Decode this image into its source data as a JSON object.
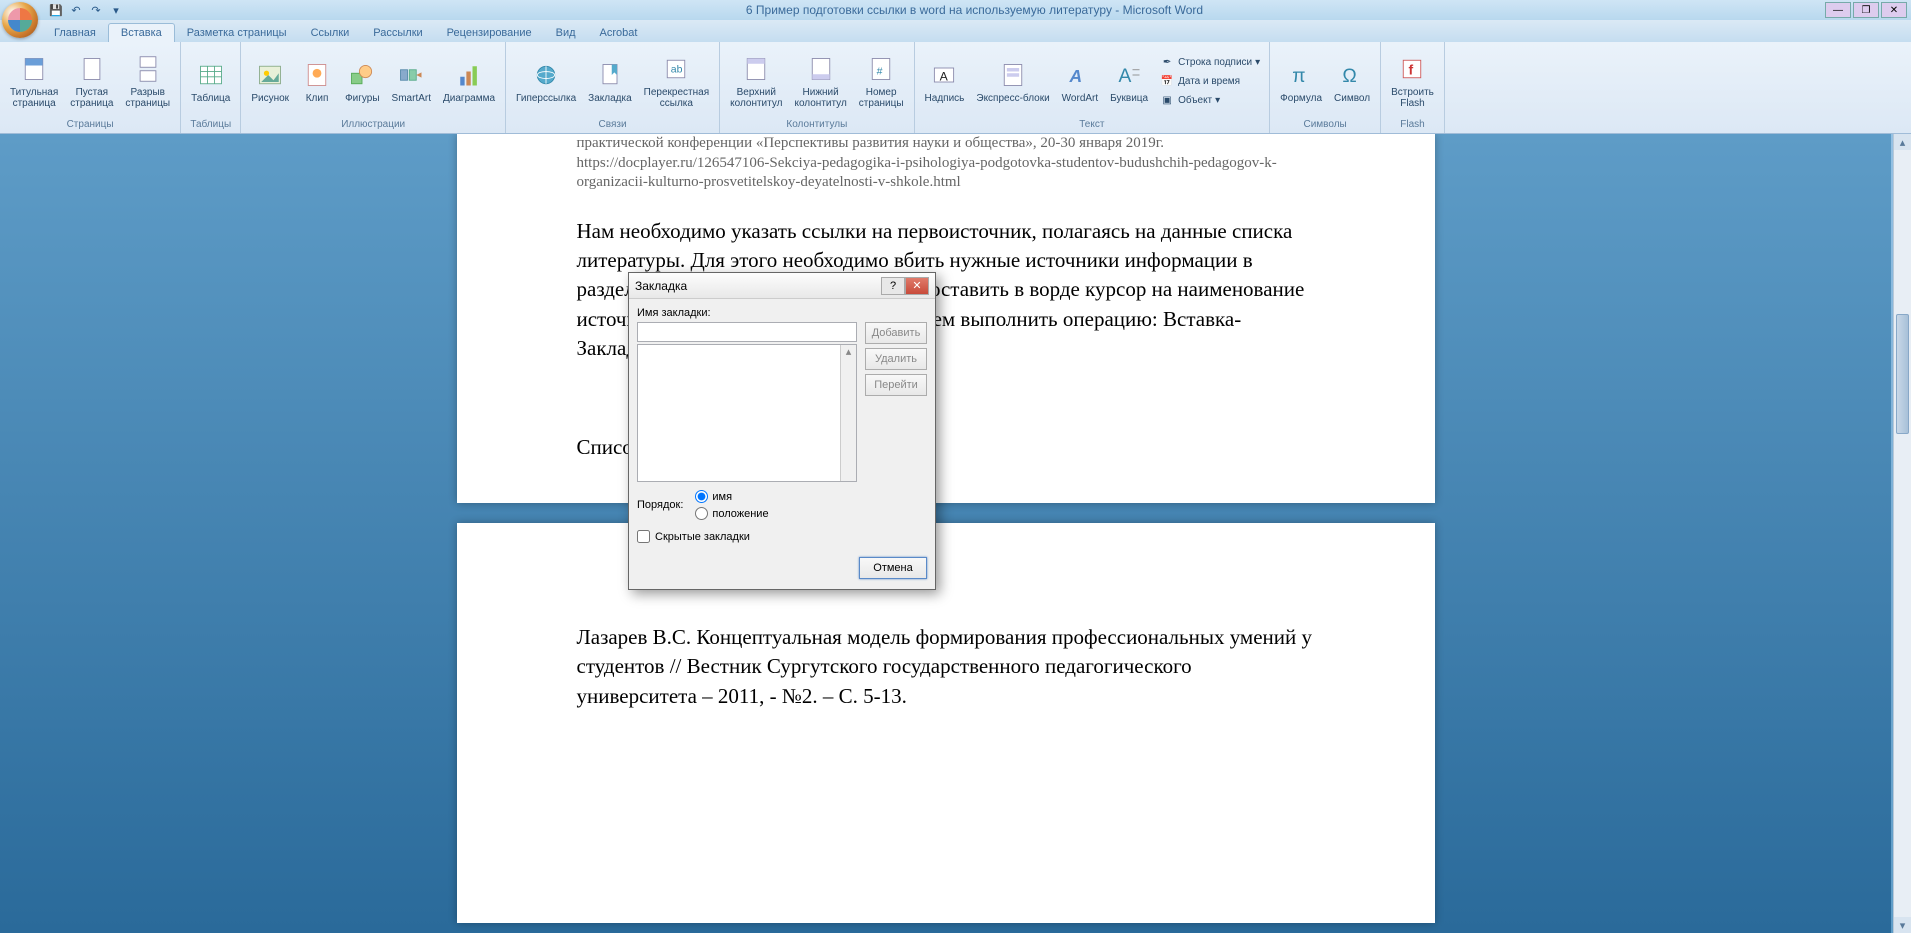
{
  "app": {
    "title": "6 Пример подготовки ссылки в word на используемую литературу - Microsoft Word"
  },
  "tabs": {
    "home": "Главная",
    "insert": "Вставка",
    "layout": "Разметка страницы",
    "refs": "Ссылки",
    "mailings": "Рассылки",
    "review": "Рецензирование",
    "view": "Вид",
    "acrobat": "Acrobat"
  },
  "ribbon": {
    "pages": {
      "cover": "Титульная\nстраница",
      "blank": "Пустая\nстраница",
      "break": "Разрыв\nстраницы",
      "label": "Страницы"
    },
    "tables": {
      "table": "Таблица",
      "label": "Таблицы"
    },
    "illustrations": {
      "picture": "Рисунок",
      "clip": "Клип",
      "shapes": "Фигуры",
      "smartart": "SmartArt",
      "chart": "Диаграмма",
      "label": "Иллюстрации"
    },
    "links": {
      "hyperlink": "Гиперссылка",
      "bookmark": "Закладка",
      "crossref": "Перекрестная\nссылка",
      "label": "Связи"
    },
    "headers": {
      "header": "Верхний\nколонтитул",
      "footer": "Нижний\nколонтитул",
      "pagenum": "Номер\nстраницы",
      "label": "Колонтитулы"
    },
    "text": {
      "textbox": "Надпись",
      "quickparts": "Экспресс-блоки",
      "wordart": "WordArt",
      "dropcap": "Буквица",
      "sigline": "Строка подписи",
      "datetime": "Дата и время",
      "object": "Объект",
      "label": "Текст"
    },
    "symbols": {
      "equation": "Формула",
      "symbol": "Символ",
      "label": "Символы"
    },
    "flash": {
      "embed": "Встроить\nFlash",
      "label": "Flash"
    }
  },
  "document": {
    "para1a": "практической конференции «Перспективы развития науки и общества», 20-30 января 2019г.",
    "para1b": "https://docplayer.ru/126547106-Sekciya-pedagogika-i-psihologiya-podgotovka-studentov-budushchih-pedagogov-k-organizacii-kulturno-prosvetitelskoy-deyatelnosti-v-shkole.html",
    "para2": "Нам необходимо указать ссылки на первоисточник, полагаясь на данные списка литературы. Для этого необходимо вбить нужные источники информации в раздел «Закладка». Для начала нужно поставить в ворде курсор на наименование источника (из списка литературы), а затем выполнить операцию: Вставка-Закладка",
    "heading": "Список литературы:",
    "para3": "Лазарев В.С. Концептуальная модель формирования профессиональных умений у студентов // Вестник Сургутского государственного педагогического университета – 2011, - №2. – С. 5-13."
  },
  "dialog": {
    "title": "Закладка",
    "name_label": "Имя закладки:",
    "name_value": "",
    "add": "Добавить",
    "delete": "Удалить",
    "goto": "Перейти",
    "order_label": "Порядок:",
    "order_name": "имя",
    "order_pos": "положение",
    "hidden": "Скрытые закладки",
    "cancel": "Отмена"
  }
}
